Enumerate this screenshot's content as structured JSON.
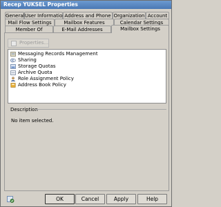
{
  "window": {
    "title": "Recep YUKSEL Properties"
  },
  "tabs": {
    "row1": [
      {
        "label": "General"
      },
      {
        "label": "User Information"
      },
      {
        "label": "Address and Phone"
      },
      {
        "label": "Organization"
      },
      {
        "label": "Account"
      }
    ],
    "row2": [
      {
        "label": "Mail Flow Settings"
      },
      {
        "label": "Mailbox Features"
      },
      {
        "label": "Calendar Settings"
      }
    ],
    "row3": [
      {
        "label": "Member Of"
      },
      {
        "label": "E-Mail Addresses"
      },
      {
        "label": "Mailbox Settings"
      }
    ],
    "active": "Mailbox Settings"
  },
  "toolbar": {
    "properties_label": "Properties..."
  },
  "settings_list": {
    "items": [
      {
        "label": "Messaging Records Management",
        "icon": "records-management-icon"
      },
      {
        "label": "Sharing",
        "icon": "sharing-icon"
      },
      {
        "label": "Storage Quotas",
        "icon": "storage-quotas-icon"
      },
      {
        "label": "Archive Quota",
        "icon": "archive-quota-icon"
      },
      {
        "label": "Role Assignment Policy",
        "icon": "role-assignment-icon"
      },
      {
        "label": "Address Book Policy",
        "icon": "address-book-icon"
      }
    ]
  },
  "description": {
    "label": "Description",
    "text": "No item selected."
  },
  "buttons": {
    "ok": "OK",
    "cancel": "Cancel",
    "apply": "Apply",
    "help": "Help"
  }
}
